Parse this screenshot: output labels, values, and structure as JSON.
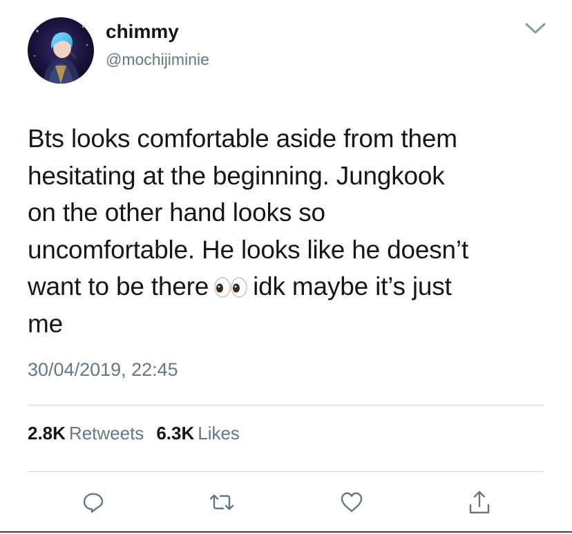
{
  "author": {
    "display_name": "chimmy",
    "handle": "@mochijiminie",
    "avatar_icon": "profile-photo"
  },
  "tweet": {
    "lines": [
      "Bts looks comfortable aside from them",
      "hesitating at the beginning. Jungkook",
      "on the other hand looks so",
      "uncomfortable. He looks like he doesn’t",
      "want to be there",
      "idk maybe it’s just",
      "me"
    ],
    "emoji_icon": "eyes-emoji",
    "timestamp": "30/04/2019, 22:45"
  },
  "stats": {
    "retweets_count": "2.8K",
    "retweets_label": "Retweets",
    "likes_count": "6.3K",
    "likes_label": "Likes"
  },
  "actions": {
    "icons": [
      "reply-icon",
      "retweet-icon",
      "like-icon",
      "share-icon"
    ]
  },
  "colors": {
    "primary_text": "#14171a",
    "secondary_text": "#657786",
    "divider": "#ccd6dd",
    "icon": "#657786"
  }
}
